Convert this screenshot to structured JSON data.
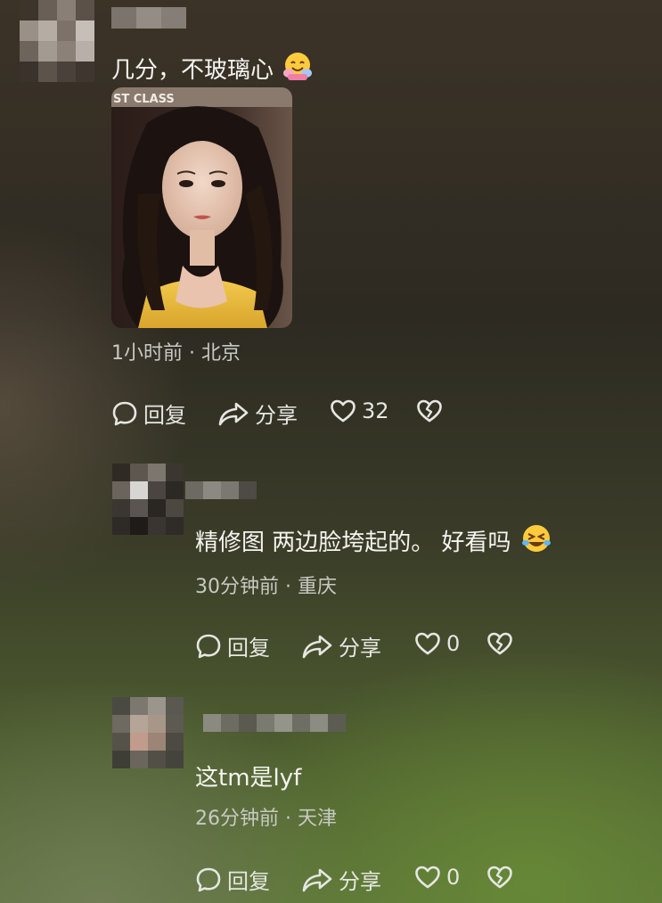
{
  "comment1": {
    "text": "几分，不玻璃心",
    "emoji_icon": "hugging-face-icon",
    "meta": "1小时前 · 北京",
    "image_icon": "portrait-photo",
    "photo_sign_text": "ST CLASS",
    "actions": {
      "reply": "回复",
      "share": "分享",
      "likes": "32"
    }
  },
  "reply1": {
    "text": "精修图 两边脸垮起的。 好看吗",
    "emoji_icon": "rolling-laughing-face-icon",
    "meta": "30分钟前 · 重庆",
    "actions": {
      "reply": "回复",
      "share": "分享",
      "likes": "0"
    }
  },
  "reply2": {
    "text": "这tm是lyf",
    "meta": "26分钟前 · 天津",
    "actions": {
      "reply": "回复",
      "share": "分享",
      "likes": "0"
    }
  },
  "colors": {
    "text": "#f4f4f0",
    "meta": "#c9c9c3",
    "icon": "#e6e6e2"
  }
}
